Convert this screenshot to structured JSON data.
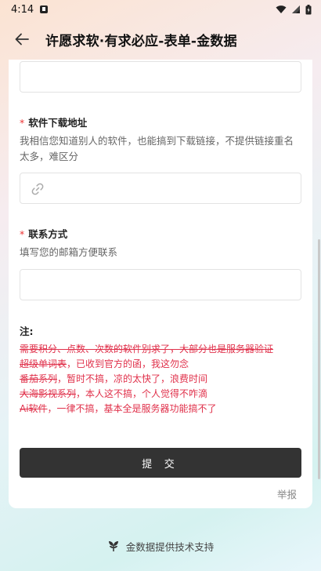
{
  "status_bar": {
    "time": "4:14"
  },
  "header": {
    "title": "许愿求软·有求必应-表单-金数据"
  },
  "form": {
    "fields": [
      {
        "label": "软件下载地址",
        "required": "*",
        "description": "我相信您知道别人的软件，也能搞到下载链接，不提供链接重名太多，难区分"
      },
      {
        "label": "联系方式",
        "required": "*",
        "description": "填写您的邮箱方便联系"
      }
    ],
    "note_title": "注:",
    "notes": [
      {
        "struck": "需要积分、点数、次数的软件别求了，大部分也是服务器验证",
        "rest": ""
      },
      {
        "struck": "超级单词表",
        "rest": "，已收到官方的函，我这勿念"
      },
      {
        "struck": "番茄系列",
        "rest": "，暂时不搞，凉的太快了，浪费时间"
      },
      {
        "struck": "大海影视系列",
        "rest": "，本人这不搞，个人觉得不咋滴"
      },
      {
        "struck": "Ai软件",
        "rest": "，一律不搞，基本全是服务器功能搞不了"
      }
    ],
    "submit_label": "提 交",
    "report_label": "举报"
  },
  "footer": {
    "text": "金数据提供技术支持"
  }
}
